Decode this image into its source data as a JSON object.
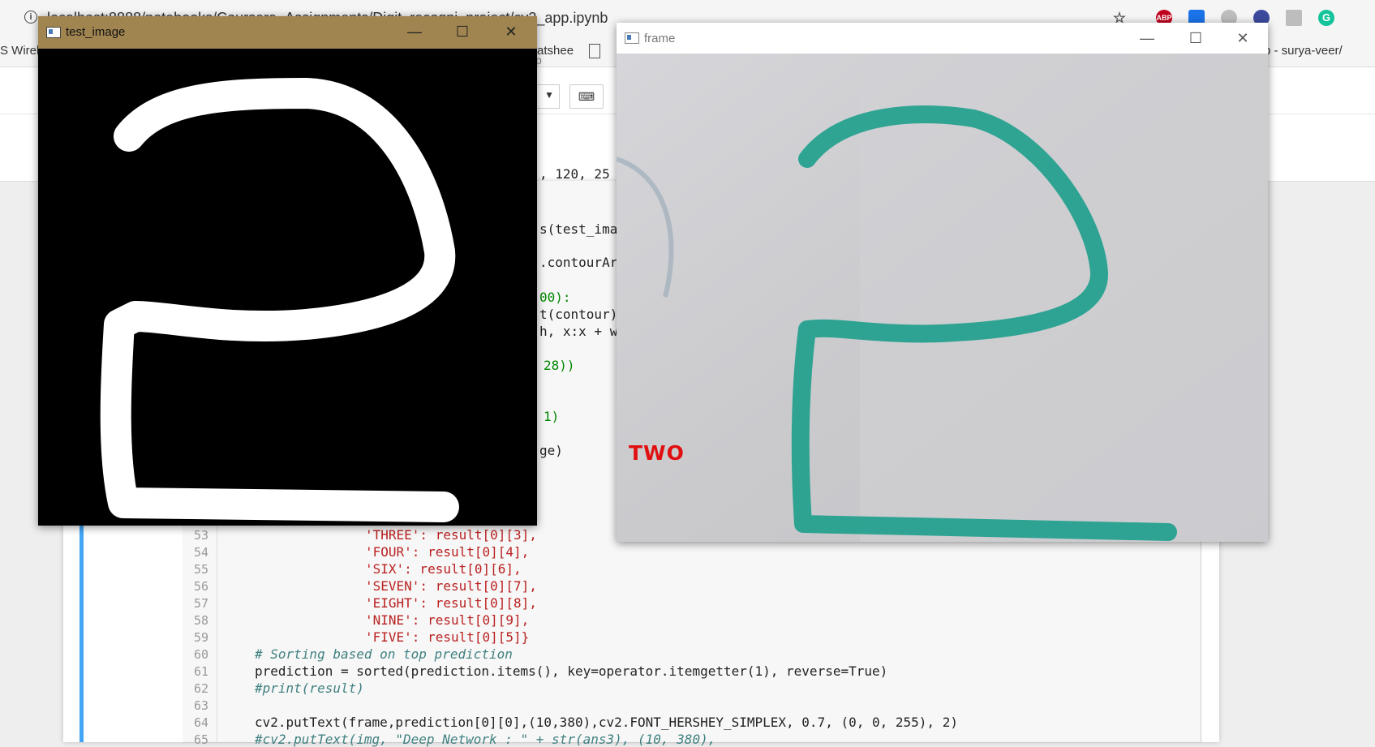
{
  "browser": {
    "url": "localhost:8888/notebooks/Coursera_Assignments/Digit_recogni_project/cv2_app.ipynb",
    "info_icon": "info-icon",
    "extensions": [
      {
        "name": "star-icon",
        "color": "#555555"
      },
      {
        "name": "adblock-icon",
        "label": "ABP",
        "color": "#c0001a"
      },
      {
        "name": "screencast-icon",
        "color": "#1a73e8"
      },
      {
        "name": "extension-gray-icon",
        "color": "#9e9e9e"
      },
      {
        "name": "blocker-icon",
        "color": "#3b4a9c"
      },
      {
        "name": "drive-icon",
        "color": "#9e9e9e"
      },
      {
        "name": "grammarly-icon",
        "label": "G",
        "color": "#15c39a"
      }
    ],
    "bookmarks": {
      "left": "S Wirel",
      "middle": "atshee",
      "right": "b - surya-veer/"
    }
  },
  "jupyter": {
    "header_fragment": "p",
    "keyboard_icon": "keyboard-icon",
    "dropdown_arrow": "▼"
  },
  "code_fragments": [
    {
      "text": ", 120, 25"
    },
    {
      "text": "s(test_imag"
    },
    {
      "text": ".contourAr"
    },
    {
      "text": "00):"
    },
    {
      "text": "t(contour)"
    },
    {
      "text": "h, x:x + w"
    },
    {
      "text": "28))"
    },
    {
      "text": "1)"
    },
    {
      "text": "ge)"
    }
  ],
  "code_lines": [
    {
      "n": "53",
      "text": "'THREE': result[0][3],"
    },
    {
      "n": "54",
      "text": "'FOUR': result[0][4],"
    },
    {
      "n": "55",
      "text": "'SIX': result[0][6],"
    },
    {
      "n": "56",
      "text": "'SEVEN': result[0][7],"
    },
    {
      "n": "57",
      "text": "'EIGHT': result[0][8],"
    },
    {
      "n": "58",
      "text": "'NINE': result[0][9],"
    },
    {
      "n": "59",
      "text": "'FIVE': result[0][5]}"
    },
    {
      "n": "60",
      "text": "# Sorting based on top prediction"
    },
    {
      "n": "61",
      "text": "prediction = sorted(prediction.items(), key=operator.itemgetter(1), reverse=True)"
    },
    {
      "n": "62",
      "text": "#print(result)"
    },
    {
      "n": "63",
      "text": ""
    },
    {
      "n": "64",
      "text": "cv2.putText(frame,prediction[0][0],(10,380),cv2.FONT_HERSHEY_SIMPLEX, 0.7, (0, 0, 255), 2)"
    },
    {
      "n": "65",
      "text": "#cv2.putText(img, \"Deep Network : \" + str(ans3), (10, 380),"
    }
  ],
  "windows": {
    "test_image": {
      "title": "test_image",
      "minimize": "—",
      "maximize": "☐",
      "close": "✕"
    },
    "frame": {
      "title": "frame",
      "minimize": "—",
      "maximize": "☐",
      "close": "✕",
      "prediction_label": "TWO",
      "ink_color": "#1e9e8c",
      "label_color": "#e01010"
    }
  }
}
